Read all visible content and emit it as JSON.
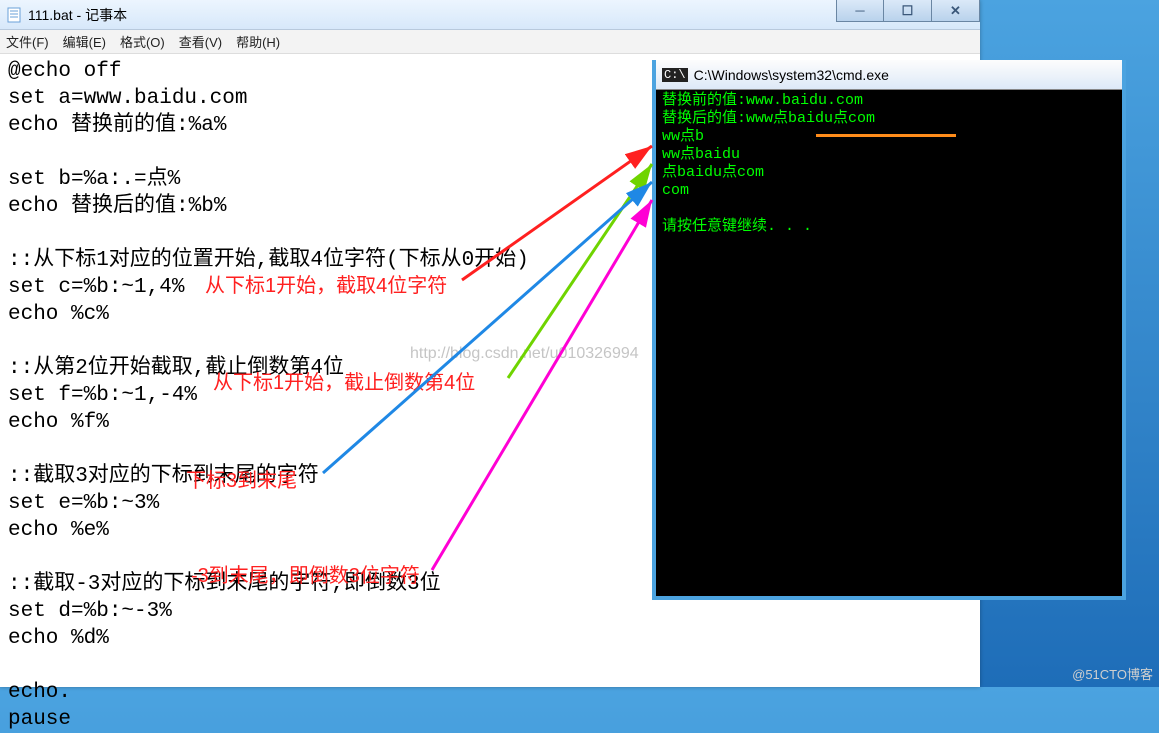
{
  "notepad": {
    "title": "111.bat - 记事本",
    "menu": {
      "file": "文件(F)",
      "edit": "编辑(E)",
      "format": "格式(O)",
      "view": "查看(V)",
      "help": "帮助(H)"
    },
    "src": "@echo off\nset a=www.baidu.com\necho 替换前的值:%a%\n\nset b=%a:.=点%\necho 替换后的值:%b%\n\n::从下标1对应的位置开始,截取4位字符(下标从0开始)\nset c=%b:~1,4%\necho %c%\n\n::从第2位开始截取,截止倒数第4位\nset f=%b:~1,-4%\necho %f%\n\n::截取3对应的下标到末尾的字符\nset e=%b:~3%\necho %e%\n\n::截取-3对应的下标到末尾的字符,即倒数3位\nset d=%b:~-3%\necho %d%\n\necho.\npause"
  },
  "annotations": {
    "a1": "从下标1开始，截取4位字符",
    "a2": "从下标1开始，截止倒数第4位",
    "a3": "下标3到末尾",
    "a4": "-3到末尾，即倒数3位字符"
  },
  "cmd": {
    "title": "C:\\Windows\\system32\\cmd.exe",
    "out": "替换前的值:www.baidu.com\n替换后的值:www点baidu点com\nww点b\nww点baidu\n点baidu点com\ncom\n\n请按任意键继续. . ."
  },
  "watermark_center": "http://blog.csdn.net/u010326994",
  "watermark_br": "@51CTO博客"
}
